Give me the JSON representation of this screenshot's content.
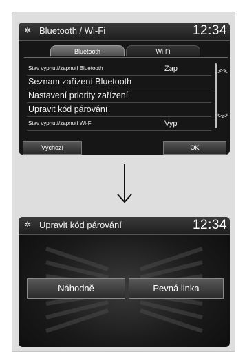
{
  "screen1": {
    "title": "Bluetooth / Wi-Fi",
    "clock": "12:34",
    "tabs": [
      {
        "label": "Bluetooth",
        "active": true
      },
      {
        "label": "Wi-Fi",
        "active": false
      }
    ],
    "rows": [
      {
        "label": "Stav vypnutí/zapnutí Bluetooth",
        "value": "Zap"
      },
      {
        "label": "Seznam zařízení Bluetooth",
        "value": ""
      },
      {
        "label": "Nastavení priority zařízení",
        "value": ""
      },
      {
        "label": "Upravit kód párování",
        "value": ""
      },
      {
        "label": "Stav vypnutí/zapnutí Wi-Fi",
        "value": "Vyp"
      }
    ],
    "buttons": {
      "default": "Výchozí",
      "ok": "OK"
    }
  },
  "screen2": {
    "title": "Upravit kód párování",
    "clock": "12:34",
    "buttons": {
      "random": "Náhodně",
      "fixed": "Pevná linka"
    }
  },
  "colors": {
    "panel_bg": "#dedede",
    "screen_bg": "#161616",
    "text": "#f0f0f0"
  }
}
